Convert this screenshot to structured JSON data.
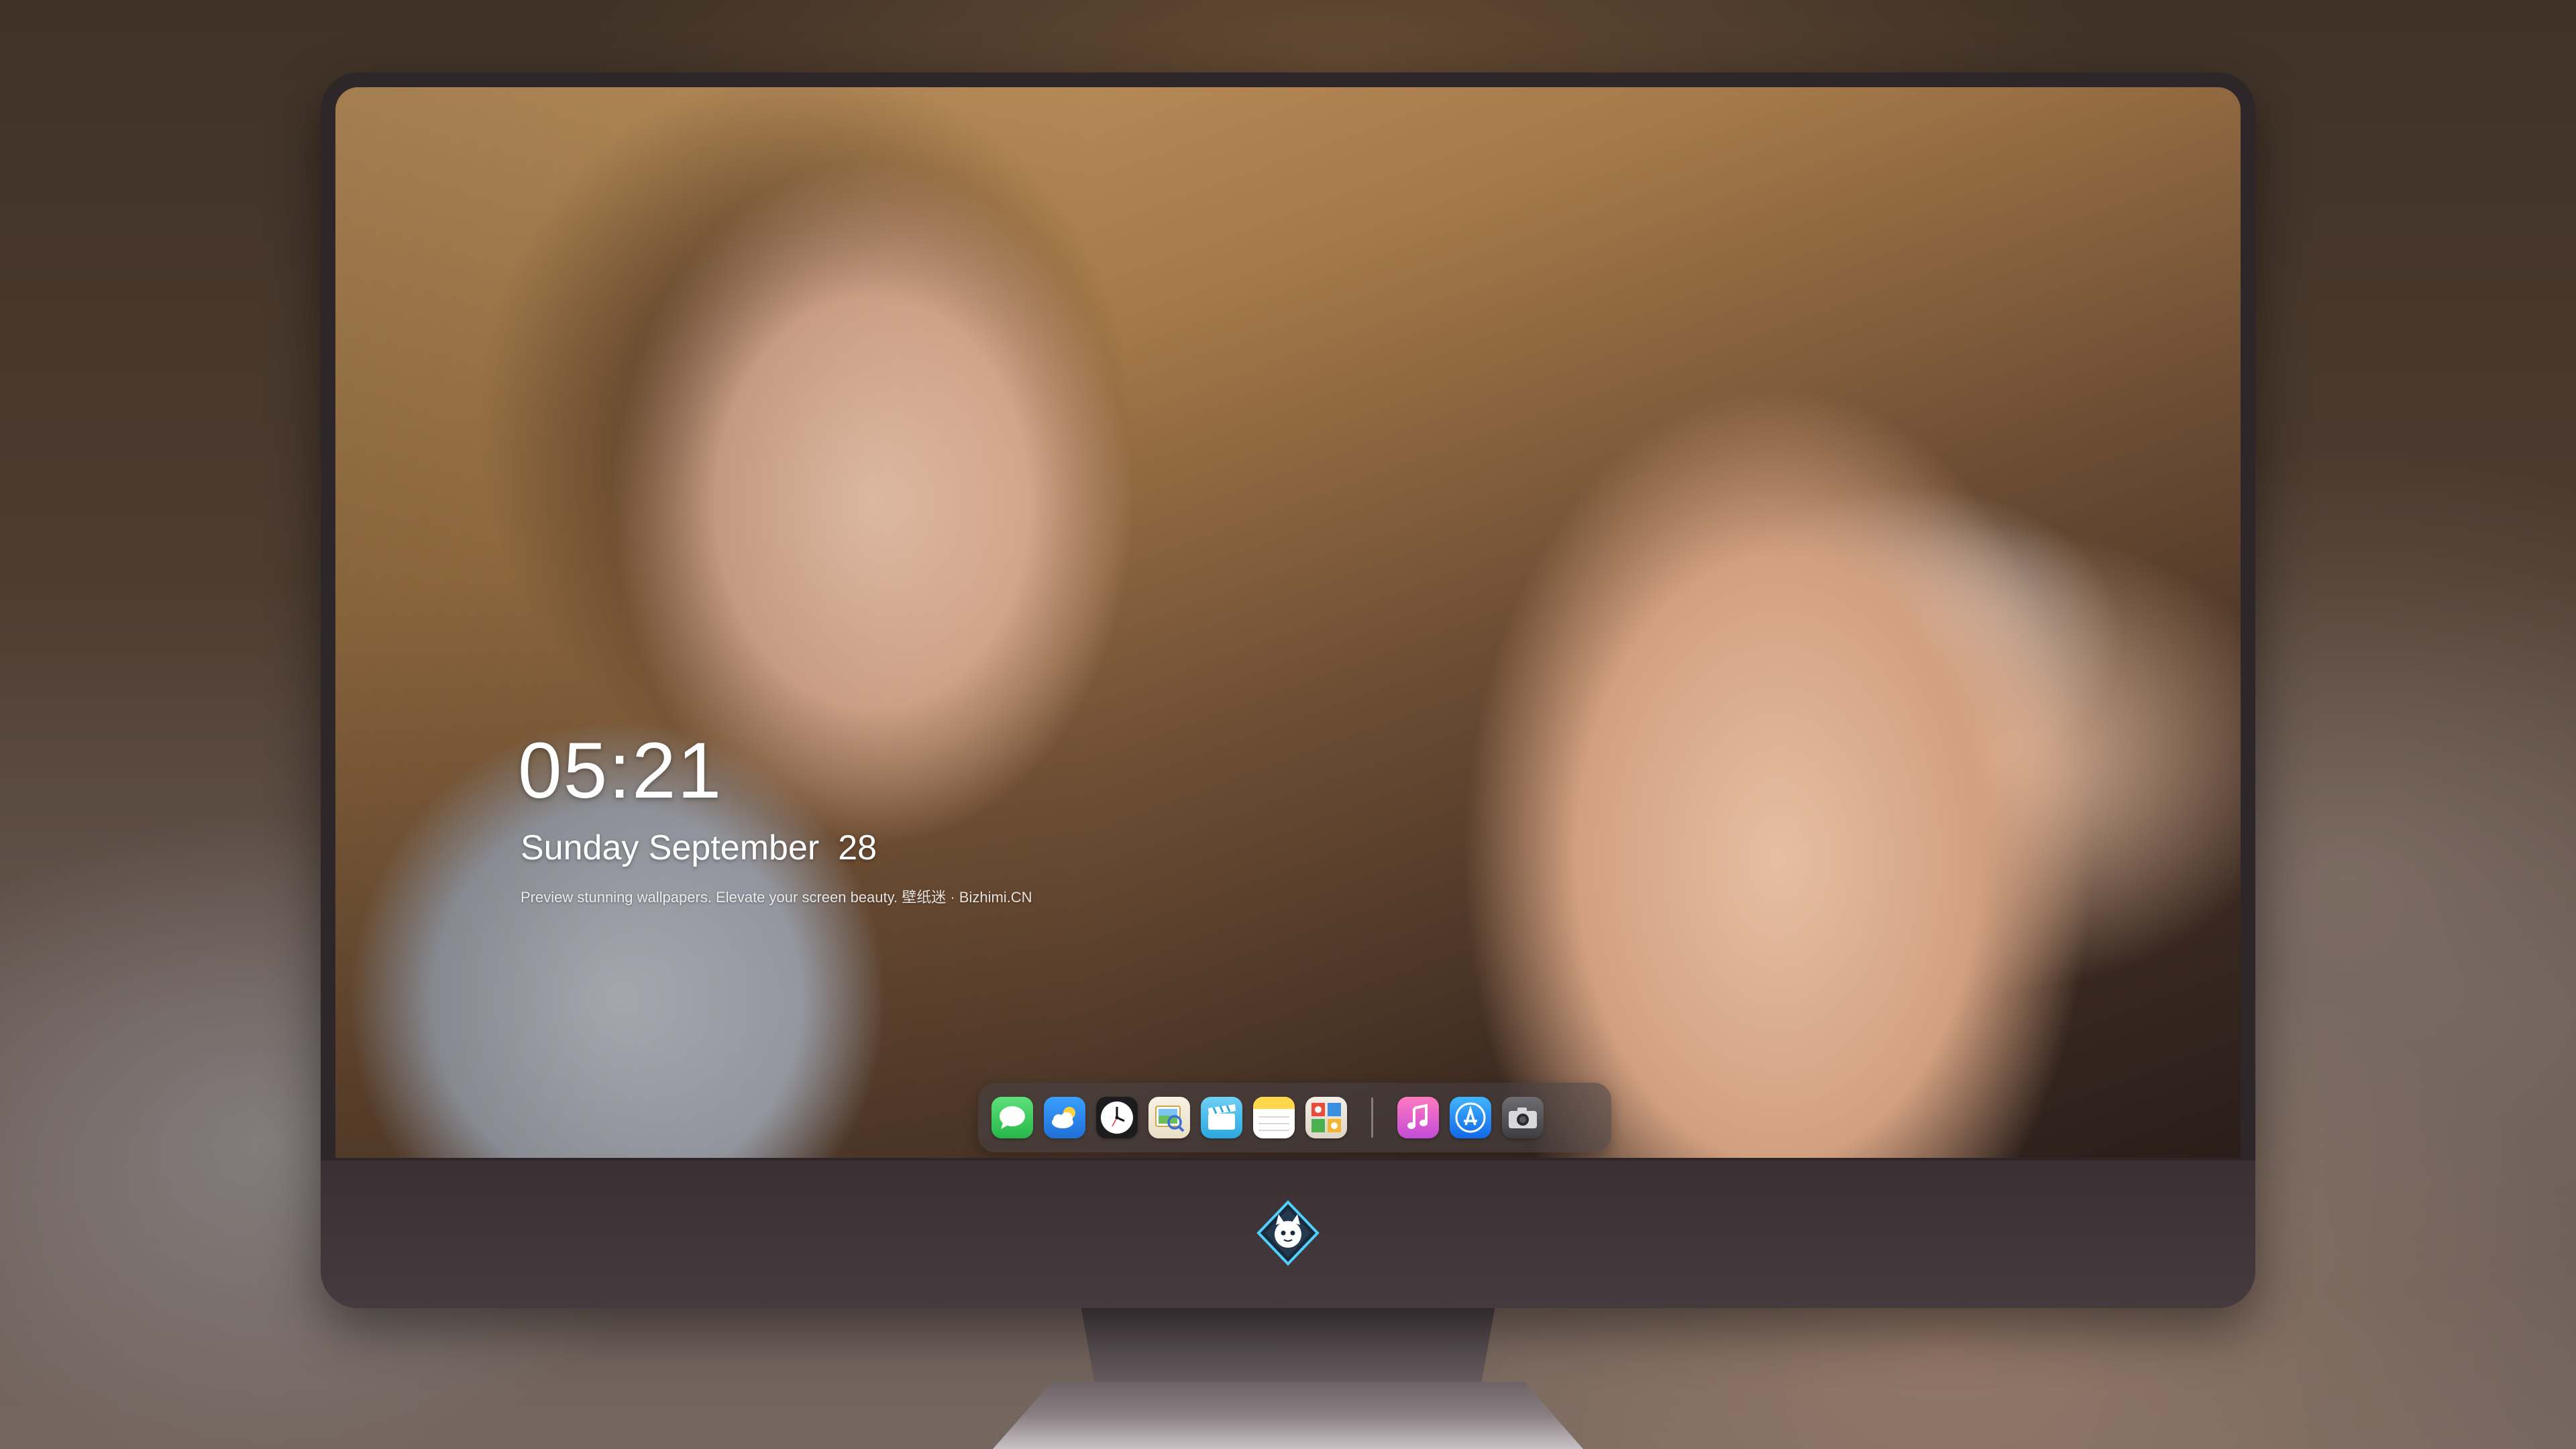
{
  "lockscreen": {
    "time": "05:21",
    "weekday_month": "Sunday September",
    "day": "28",
    "tagline": "Preview stunning wallpapers. Elevate your screen beauty. 壁纸迷 · Bizhimi.CN"
  },
  "dock": {
    "apps": [
      {
        "name": "messages-icon",
        "color": "#34c759"
      },
      {
        "name": "weather-icon",
        "color": "#2f8cf0"
      },
      {
        "name": "clock-icon",
        "color": "#1c1c1e"
      },
      {
        "name": "preview-icon",
        "color": "#f2c94c"
      },
      {
        "name": "clips-icon",
        "color": "#4fb7e6"
      },
      {
        "name": "notes-icon",
        "color": "#ffd84a"
      },
      {
        "name": "photo-booth-icon",
        "color": "#e7e2d8"
      },
      {
        "name": "music-icon",
        "color": "#ff4fa3"
      },
      {
        "name": "app-store-icon",
        "color": "#1a8cff"
      },
      {
        "name": "camera-icon",
        "color": "#5a5a5e"
      }
    ]
  },
  "brand": {
    "logo_name": "bizhimi-cat-logo-icon"
  }
}
